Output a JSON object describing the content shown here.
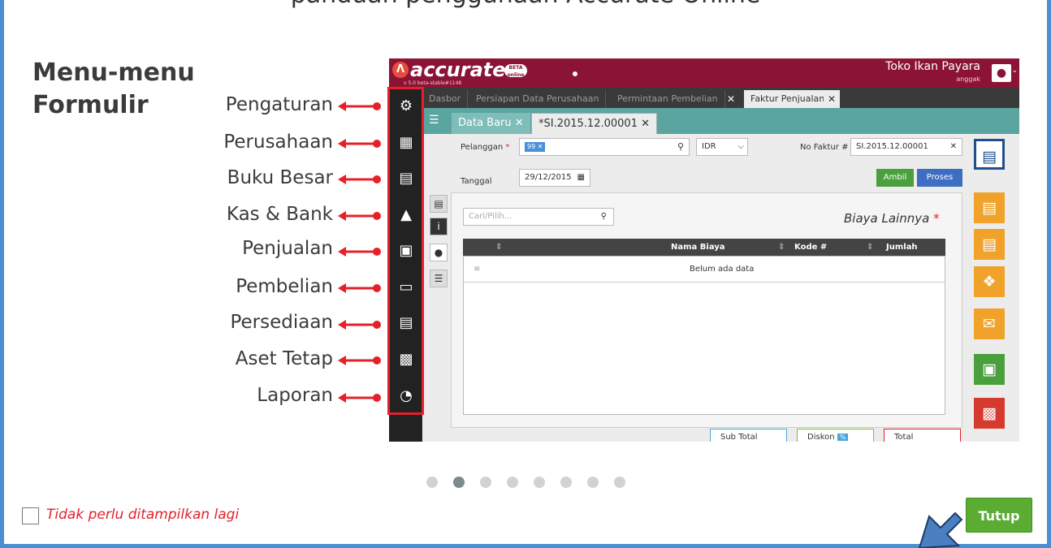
{
  "header_cut_text": "panduan penggunaan Accurate Online",
  "heading": {
    "line1": "Menu-menu",
    "line2": "Formulir"
  },
  "menu_items": [
    {
      "label": "Pengaturan",
      "icon": "gear-icon"
    },
    {
      "label": "Perusahaan",
      "icon": "building-icon"
    },
    {
      "label": "Buku Besar",
      "icon": "ledger-icon"
    },
    {
      "label": "Kas & Bank",
      "icon": "cash-bank-icon"
    },
    {
      "label": "Penjualan",
      "icon": "cart-icon"
    },
    {
      "label": "Pembelian",
      "icon": "shopping-bag-icon"
    },
    {
      "label": "Persediaan",
      "icon": "inventory-icon"
    },
    {
      "label": "Aset Tetap",
      "icon": "fixed-asset-icon"
    },
    {
      "label": "Laporan",
      "icon": "pie-chart-icon"
    }
  ],
  "app": {
    "logo_text": "accurate",
    "logo_version": "v 5.0 beta-stable#1148",
    "logo_badge": "BETA",
    "logo_badge_sub": "online",
    "company_name": "Toko Ikan Payara",
    "company_user": "anggak",
    "tabs": [
      "Dasbor",
      "Persiapan Data Perusahaan",
      "Permintaan Pembelian",
      "Faktur Penjualan"
    ],
    "sub_tabs": [
      "Data Baru",
      "*SI.2015.12.00001"
    ],
    "form": {
      "customer_label": "Pelanggan",
      "customer_chip": "99",
      "currency": "IDR",
      "invoice_no_label": "No Faktur #",
      "invoice_no_value": "SI.2015.12.00001",
      "date_label": "Tanggal",
      "date_value": "29/12/2015",
      "btn_take": "Ambil",
      "btn_process": "Proses"
    },
    "panel": {
      "search_placeholder": "Cari/Pilih...",
      "title": "Biaya Lainnya",
      "columns": [
        "Nama Biaya",
        "Kode #",
        "Jumlah"
      ],
      "empty_text": "Belum ada data"
    },
    "totals": [
      "Sub Total",
      "Diskon",
      "Total"
    ],
    "totals_colors": [
      "#4aa3d9",
      "#7cbf3c",
      "#e5202a"
    ]
  },
  "pager": {
    "count": 8,
    "active_index": 1
  },
  "dont_show_label": "Tidak perlu ditampilkan lagi",
  "close_button": "Tutup",
  "colors": {
    "frame": "#4a8fd4",
    "app_top": "#8b1436",
    "accent_red": "#e5202a",
    "close_green": "#5aac32"
  }
}
